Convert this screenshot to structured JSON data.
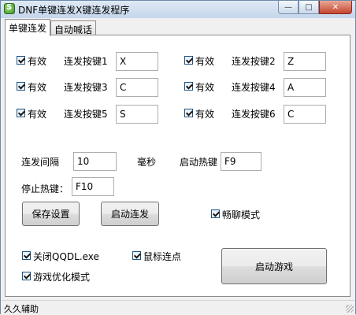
{
  "window": {
    "title": "DNF单键连发X键连发程序",
    "buttons": {
      "minimize": "—",
      "maximize": "□",
      "close": "✕"
    },
    "icon_glyph": "S"
  },
  "tabs": [
    {
      "label": "单键连发",
      "active": true
    },
    {
      "label": "自动喊话",
      "active": false
    }
  ],
  "keys": [
    {
      "valid_label": "有效",
      "label": "连发按键1",
      "value": "X",
      "checked": true
    },
    {
      "valid_label": "有效",
      "label": "连发按键2",
      "value": "Z",
      "checked": true
    },
    {
      "valid_label": "有效",
      "label": "连发按键3",
      "value": "C",
      "checked": true
    },
    {
      "valid_label": "有效",
      "label": "连发按键4",
      "value": "A",
      "checked": true
    },
    {
      "valid_label": "有效",
      "label": "连发按键5",
      "value": "S",
      "checked": true
    },
    {
      "valid_label": "有效",
      "label": "连发按键6",
      "value": "C",
      "checked": true
    }
  ],
  "interval": {
    "label": "连发间隔",
    "value": "10",
    "unit": "毫秒"
  },
  "start_hotkey": {
    "label": "启动热键",
    "value": "F9"
  },
  "stop_hotkey": {
    "label": "停止热键：",
    "value": "F10"
  },
  "buttons": {
    "save": "保存设置",
    "start_repeat": "启动连发",
    "start_game": "启动游戏"
  },
  "options": {
    "smooth_chat": {
      "label": "畅聊模式",
      "checked": true
    },
    "close_qqdl": {
      "label": "关闭QQDL.exe",
      "checked": true
    },
    "mouse_click": {
      "label": "鼠标连点",
      "checked": true
    },
    "game_optimize": {
      "label": "游戏优化模式",
      "checked": true
    }
  },
  "status": {
    "text": "久久辅助"
  }
}
